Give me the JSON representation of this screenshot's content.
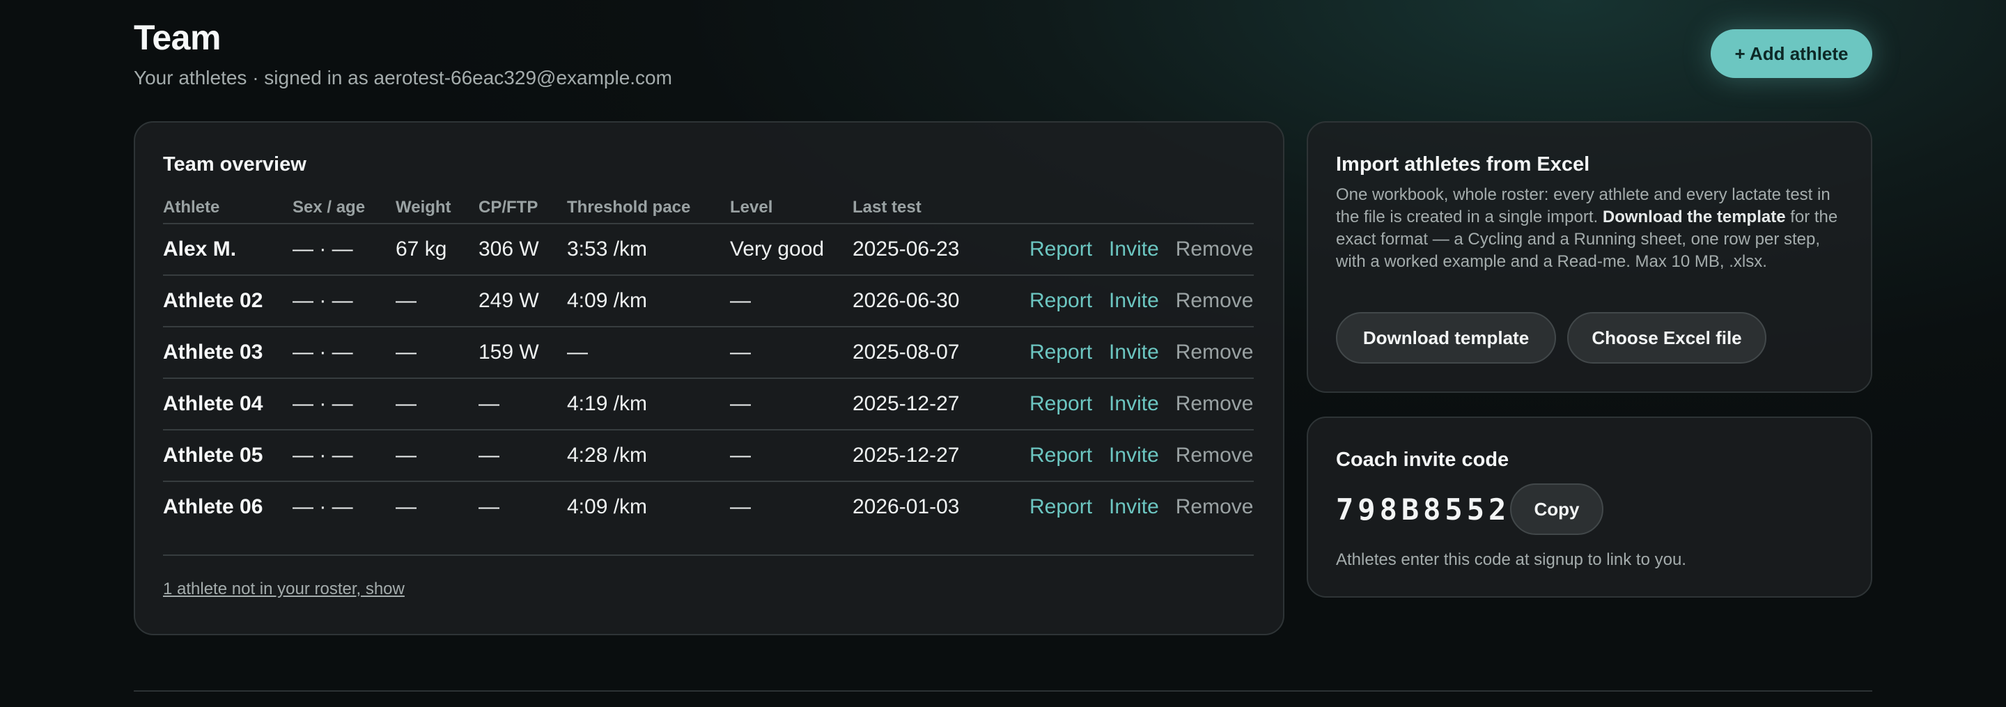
{
  "header": {
    "title": "Team",
    "subtitle": "Your athletes · signed in as aerotest-66eac329@example.com",
    "add_button": "+ Add athlete"
  },
  "overview": {
    "title": "Team overview",
    "columns": [
      "Athlete",
      "Sex / age",
      "Weight",
      "CP/FTP",
      "Threshold pace",
      "Level",
      "Last test",
      ""
    ],
    "rows": [
      {
        "name": "Alex M.",
        "sex_age": "— · —",
        "weight": "67 kg",
        "cp": "306 W",
        "pace": "3:53 /km",
        "level": "Very good",
        "last_test": "2025-06-23"
      },
      {
        "name": "Athlete 02",
        "sex_age": "— · —",
        "weight": "—",
        "cp": "249 W",
        "pace": "4:09 /km",
        "level": "—",
        "last_test": "2026-06-30"
      },
      {
        "name": "Athlete 03",
        "sex_age": "— · —",
        "weight": "—",
        "cp": "159 W",
        "pace": "—",
        "level": "—",
        "last_test": "2025-08-07"
      },
      {
        "name": "Athlete 04",
        "sex_age": "— · —",
        "weight": "—",
        "cp": "—",
        "pace": "4:19 /km",
        "level": "—",
        "last_test": "2025-12-27"
      },
      {
        "name": "Athlete 05",
        "sex_age": "— · —",
        "weight": "—",
        "cp": "—",
        "pace": "4:28 /km",
        "level": "—",
        "last_test": "2025-12-27"
      },
      {
        "name": "Athlete 06",
        "sex_age": "— · —",
        "weight": "—",
        "cp": "—",
        "pace": "4:09 /km",
        "level": "—",
        "last_test": "2026-01-03"
      }
    ],
    "actions": {
      "report": "Report",
      "invite": "Invite",
      "remove": "Remove"
    },
    "hidden_link": "1 athlete not in your roster, show"
  },
  "import": {
    "title": "Import athletes from Excel",
    "desc_before": "One workbook, whole roster: every athlete and every lactate test in the file is created in a single import. ",
    "desc_bold": "Download the template",
    "desc_after": " for the exact format — a Cycling and a Running sheet, one row per step, with a worked example and a Read-me. Max 10 MB, .xlsx.",
    "download_button": "Download template",
    "choose_button": "Choose Excel file"
  },
  "invite": {
    "title": "Coach invite code",
    "code": "798B8552",
    "copy_button": "Copy",
    "hint": "Athletes enter this code at signup to link to you."
  },
  "colors": {
    "accent": "#6cc6c1",
    "background": "#0b1011",
    "card": "#1c1f21",
    "muted_text": "#a4acac"
  }
}
